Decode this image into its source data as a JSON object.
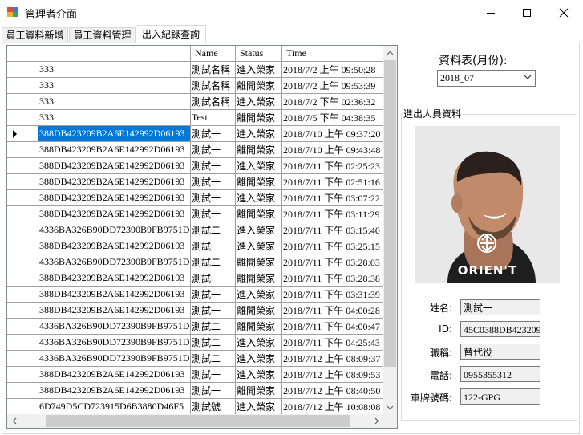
{
  "window": {
    "title": "管理者介面"
  },
  "tabs": [
    {
      "label": "員工資料新增"
    },
    {
      "label": "員工資料管理"
    },
    {
      "label": "出入紀錄查詢"
    }
  ],
  "grid": {
    "columns": [
      "Name",
      "Status",
      "Time"
    ],
    "rows": [
      {
        "id": "333",
        "name": "測試名稱",
        "status": "進入榮家",
        "time": "2018/7/2 上午 09:50:28"
      },
      {
        "id": "333",
        "name": "測試名稱",
        "status": "離開榮家",
        "time": "2018/7/2 上午 09:53:39"
      },
      {
        "id": "333",
        "name": "測試名稱",
        "status": "進入榮家",
        "time": "2018/7/2 下午 02:36:32"
      },
      {
        "id": "333",
        "name": "Test",
        "status": "離開榮家",
        "time": "2018/7/5 下午 04:38:35"
      },
      {
        "id": "388DB423209B2A6E142992D06193",
        "name": "測試一",
        "status": "進入榮家",
        "time": "2018/7/10 上午 09:37:20"
      },
      {
        "id": "388DB423209B2A6E142992D06193",
        "name": "測試一",
        "status": "離開榮家",
        "time": "2018/7/10 上午 09:43:48"
      },
      {
        "id": "388DB423209B2A6E142992D06193",
        "name": "測試一",
        "status": "進入榮家",
        "time": "2018/7/11 下午 02:25:23"
      },
      {
        "id": "388DB423209B2A6E142992D06193",
        "name": "測試一",
        "status": "離開榮家",
        "time": "2018/7/11 下午 02:51:16"
      },
      {
        "id": "388DB423209B2A6E142992D06193",
        "name": "測試一",
        "status": "進入榮家",
        "time": "2018/7/11 下午 03:07:22"
      },
      {
        "id": "388DB423209B2A6E142992D06193",
        "name": "測試一",
        "status": "離開榮家",
        "time": "2018/7/11 下午 03:11:29"
      },
      {
        "id": "4336BA326B90DD72390B9FB9751D",
        "name": "測試二",
        "status": "進入榮家",
        "time": "2018/7/11 下午 03:15:40"
      },
      {
        "id": "388DB423209B2A6E142992D06193",
        "name": "測試一",
        "status": "進入榮家",
        "time": "2018/7/11 下午 03:25:15"
      },
      {
        "id": "4336BA326B90DD72390B9FB9751D",
        "name": "測試二",
        "status": "離開榮家",
        "time": "2018/7/11 下午 03:28:03"
      },
      {
        "id": "388DB423209B2A6E142992D06193",
        "name": "測試一",
        "status": "離開榮家",
        "time": "2018/7/11 下午 03:28:38"
      },
      {
        "id": "388DB423209B2A6E142992D06193",
        "name": "測試一",
        "status": "進入榮家",
        "time": "2018/7/11 下午 03:31:39"
      },
      {
        "id": "388DB423209B2A6E142992D06193",
        "name": "測試一",
        "status": "離開榮家",
        "time": "2018/7/11 下午 04:00:28"
      },
      {
        "id": "4336BA326B90DD72390B9FB9751D",
        "name": "測試二",
        "status": "離開榮家",
        "time": "2018/7/11 下午 04:00:47"
      },
      {
        "id": "4336BA326B90DD72390B9FB9751D",
        "name": "測試二",
        "status": "進入榮家",
        "time": "2018/7/11 下午 04:25:43"
      },
      {
        "id": "4336BA326B90DD72390B9FB9751D",
        "name": "測試二",
        "status": "進入榮家",
        "time": "2018/7/12 上午 08:09:37"
      },
      {
        "id": "388DB423209B2A6E142992D06193",
        "name": "測試一",
        "status": "進入榮家",
        "time": "2018/7/12 上午 08:09:53"
      },
      {
        "id": "388DB423209B2A6E142992D06193",
        "name": "測試一",
        "status": "離開榮家",
        "time": "2018/7/12 上午 08:40:50"
      },
      {
        "id": "6D749D5CD723915D6B3880D46F5",
        "name": "測試號",
        "status": "進入榮家",
        "time": "2018/7/12 上午 10:08:08"
      }
    ],
    "selected_index": 4,
    "selection_color": "#0078d7"
  },
  "datasheet": {
    "label": "資料表(月份):",
    "value": "2018_07"
  },
  "person": {
    "group_title": "進出人員資料",
    "photo_brand": "ORIEN'T",
    "fields": [
      {
        "label": "姓名:",
        "value": "測試一"
      },
      {
        "label": "ID:",
        "value": "45C0388DB423209"
      },
      {
        "label": "職稱:",
        "value": "替代役"
      },
      {
        "label": "電話:",
        "value": "0955355312"
      },
      {
        "label": "車牌號碼:",
        "value": "122-GPG"
      }
    ]
  }
}
